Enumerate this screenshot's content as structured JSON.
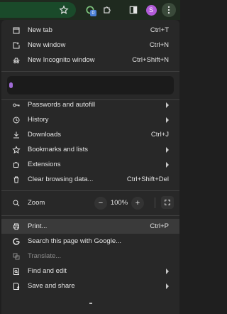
{
  "toolbar": {
    "icons": [
      "star-icon",
      "extension-badge-icon",
      "puzzle-icon",
      "side-panel-icon",
      "profile-avatar",
      "kebab-menu-icon"
    ],
    "extension_badge": "0",
    "profile_initial": "S",
    "colors": {
      "toolbar_bg": "#1f2a1f",
      "omnibox": "#1a4a2a",
      "profile": "#b05cd6"
    }
  },
  "menu": {
    "new_tab": {
      "label": "New tab",
      "shortcut": "Ctrl+T",
      "icon": "new-tab-icon"
    },
    "new_window": {
      "label": "New window",
      "shortcut": "Ctrl+N",
      "icon": "new-window-icon"
    },
    "new_incognito": {
      "label": "New Incognito window",
      "shortcut": "Ctrl+Shift+N",
      "icon": "incognito-icon"
    },
    "passwords": {
      "label": "Passwords and autofill",
      "icon": "key-icon"
    },
    "history": {
      "label": "History",
      "icon": "history-icon"
    },
    "downloads": {
      "label": "Downloads",
      "shortcut": "Ctrl+J",
      "icon": "download-icon"
    },
    "bookmarks": {
      "label": "Bookmarks and lists",
      "icon": "star-icon"
    },
    "extensions": {
      "label": "Extensions",
      "icon": "puzzle-icon"
    },
    "clear_data": {
      "label": "Clear browsing data...",
      "shortcut": "Ctrl+Shift+Del",
      "icon": "trash-icon"
    },
    "zoom": {
      "label": "Zoom",
      "value": "100%",
      "minus": "−",
      "plus": "+",
      "icon": "zoom-icon"
    },
    "print": {
      "label": "Print...",
      "shortcut": "Ctrl+P",
      "icon": "print-icon"
    },
    "search_google": {
      "label": "Search this page with Google...",
      "icon": "google-g-icon"
    },
    "translate": {
      "label": "Translate...",
      "icon": "translate-icon"
    },
    "find_edit": {
      "label": "Find and edit",
      "icon": "find-icon"
    },
    "save_share": {
      "label": "Save and share",
      "icon": "save-share-icon"
    }
  }
}
